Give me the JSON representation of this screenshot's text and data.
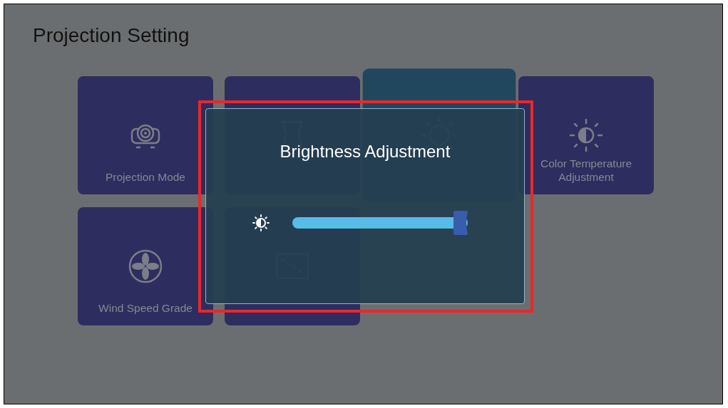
{
  "title": "Projection Setting",
  "tiles": [
    {
      "label": "Projection Mode",
      "kind": "projector",
      "selected": false
    },
    {
      "kind": "keystone",
      "selected": false
    },
    {
      "kind": "sun",
      "selected": true
    },
    {
      "label": "Color Temperature Adjustment",
      "kind": "contrast",
      "selected": false
    },
    {
      "label": "Wind Speed Grade",
      "kind": "fan",
      "selected": false
    },
    {
      "kind": "zoom",
      "selected": false
    }
  ],
  "dialog": {
    "title": "Brightness Adjustment",
    "slider": {
      "level": 1
    }
  }
}
